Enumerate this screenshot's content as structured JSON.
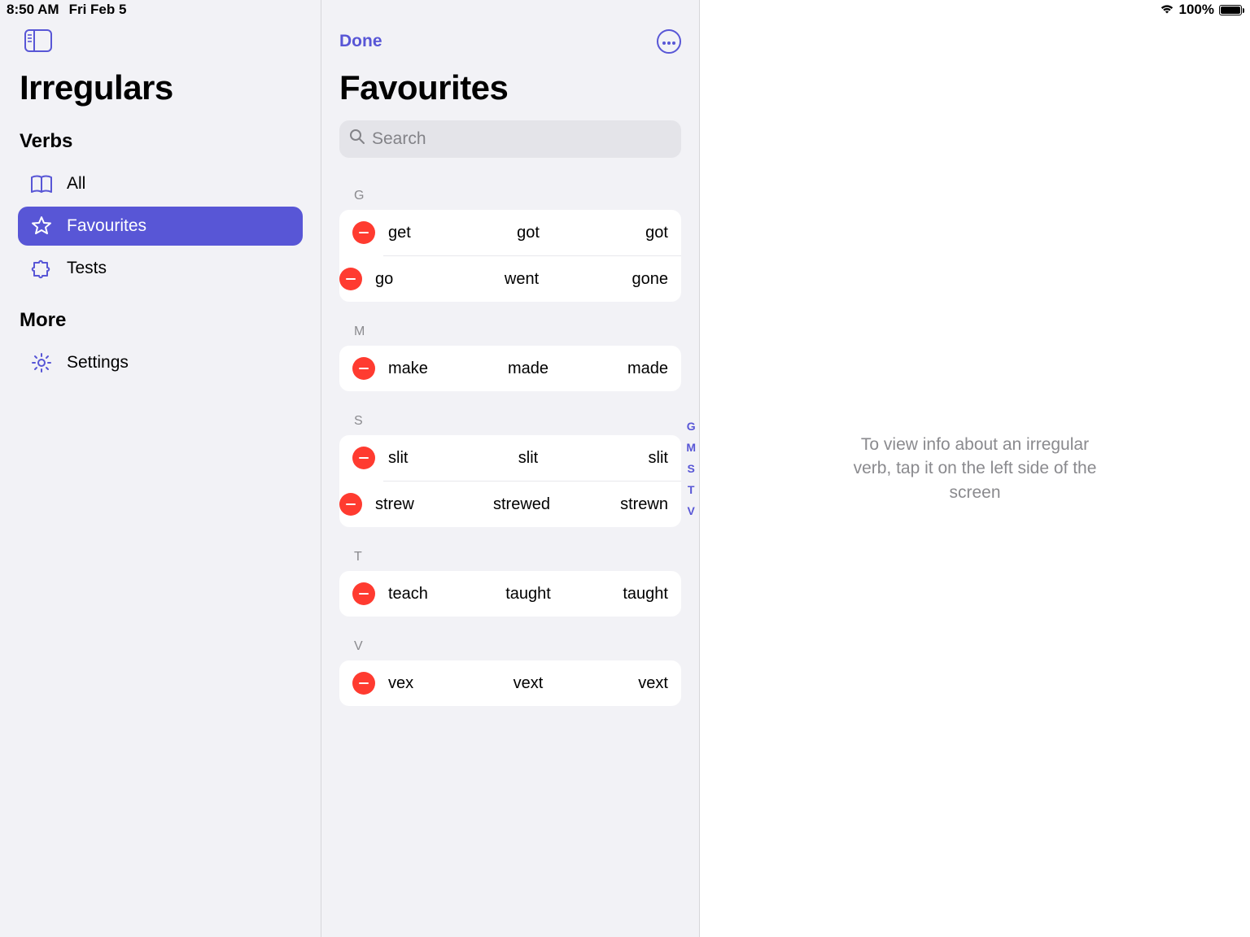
{
  "status_bar": {
    "time": "8:50 AM",
    "date": "Fri Feb 5",
    "battery_pct": "100%"
  },
  "accent_color": "#5856d6",
  "sidebar": {
    "app_title": "Irregulars",
    "sections": [
      {
        "label": "Verbs",
        "items": [
          {
            "icon": "book-open",
            "label": "All",
            "selected": false
          },
          {
            "icon": "star",
            "label": "Favourites",
            "selected": true
          },
          {
            "icon": "puzzle",
            "label": "Tests",
            "selected": false
          }
        ]
      },
      {
        "label": "More",
        "items": [
          {
            "icon": "gear",
            "label": "Settings",
            "selected": false
          }
        ]
      }
    ]
  },
  "middle": {
    "done_label": "Done",
    "title": "Favourites",
    "search_placeholder": "Search",
    "index_letters": [
      "G",
      "M",
      "S",
      "T",
      "V"
    ],
    "groups": [
      {
        "letter": "G",
        "rows": [
          {
            "base": "get",
            "past": "got",
            "participle": "got"
          },
          {
            "base": "go",
            "past": "went",
            "participle": "gone"
          }
        ]
      },
      {
        "letter": "M",
        "rows": [
          {
            "base": "make",
            "past": "made",
            "participle": "made"
          }
        ]
      },
      {
        "letter": "S",
        "rows": [
          {
            "base": "slit",
            "past": "slit",
            "participle": "slit"
          },
          {
            "base": "strew",
            "past": "strewed",
            "participle": "strewn"
          }
        ]
      },
      {
        "letter": "T",
        "rows": [
          {
            "base": "teach",
            "past": "taught",
            "participle": "taught"
          }
        ]
      },
      {
        "letter": "V",
        "rows": [
          {
            "base": "vex",
            "past": "vext",
            "participle": "vext"
          }
        ]
      }
    ]
  },
  "detail": {
    "placeholder": "To view info about an irregular verb, tap it on the left side of the screen"
  }
}
